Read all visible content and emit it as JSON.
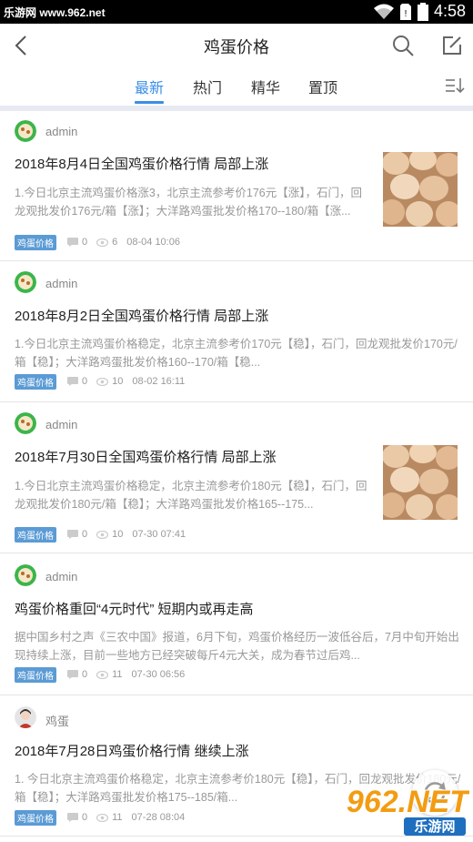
{
  "status_bar": {
    "left_text": "乐游网 www.962.net",
    "time": "4:58"
  },
  "header": {
    "title": "鸡蛋价格"
  },
  "tabs": [
    {
      "label": "最新",
      "active": true
    },
    {
      "label": "热门",
      "active": false
    },
    {
      "label": "精华",
      "active": false
    },
    {
      "label": "置顶",
      "active": false
    }
  ],
  "posts": [
    {
      "author": "admin",
      "title": "2018年8月4日全国鸡蛋价格行情 局部上涨",
      "excerpt": "1.今日北京主流鸡蛋价格涨3，北京主流参考价176元【涨】，石门，回龙观批发价176元/箱【涨】；大洋路鸡蛋批发价格170--180/箱【涨...",
      "tag": "鸡蛋价格",
      "comments": "0",
      "views": "6",
      "time": "08-04 10:06",
      "has_image": true
    },
    {
      "author": "admin",
      "title": "2018年8月2日全国鸡蛋价格行情 局部上涨",
      "excerpt": "1.今日北京主流鸡蛋价格稳定，北京主流参考价170元【稳】，石门，回龙观批发价170元/箱【稳】；大洋路鸡蛋批发价格160--170/箱【稳...",
      "tag": "鸡蛋价格",
      "comments": "0",
      "views": "10",
      "time": "08-02 16:11",
      "has_image": false
    },
    {
      "author": "admin",
      "title": "2018年7月30日全国鸡蛋价格行情 局部上涨",
      "excerpt": "1.今日北京主流鸡蛋价格稳定，北京主流参考价180元【稳】，石门，回龙观批发价180元/箱【稳】；大洋路鸡蛋批发价格165--175...",
      "tag": "鸡蛋价格",
      "comments": "0",
      "views": "10",
      "time": "07-30 07:41",
      "has_image": true
    },
    {
      "author": "admin",
      "title": "鸡蛋价格重回“4元时代” 短期内或再走高",
      "excerpt": "据中国乡村之声《三农中国》报道，6月下旬，鸡蛋价格经历一波低谷后，7月中旬开始出现持续上涨，目前一些地方已经突破每斤4元大关，成为春节过后鸡...",
      "tag": "鸡蛋价格",
      "comments": "0",
      "views": "11",
      "time": "07-30 06:56",
      "has_image": false
    },
    {
      "author": "鸡蛋",
      "title": "2018年7月28日鸡蛋价格行情 继续上涨",
      "excerpt": "1. 今日北京主流鸡蛋价格稳定，北京主流参考价180元【稳】，石门，回龙观批发价180元/箱【稳】；大洋路鸡蛋批发价格175--185/箱...",
      "tag": "鸡蛋价格",
      "comments": "0",
      "views": "11",
      "time": "07-28 08:04",
      "has_image": false
    }
  ],
  "watermark": {
    "text": "962.NET",
    "sub": "乐游网"
  },
  "colors": {
    "accent": "#3a8ee6",
    "tag": "#5b9bd5"
  }
}
